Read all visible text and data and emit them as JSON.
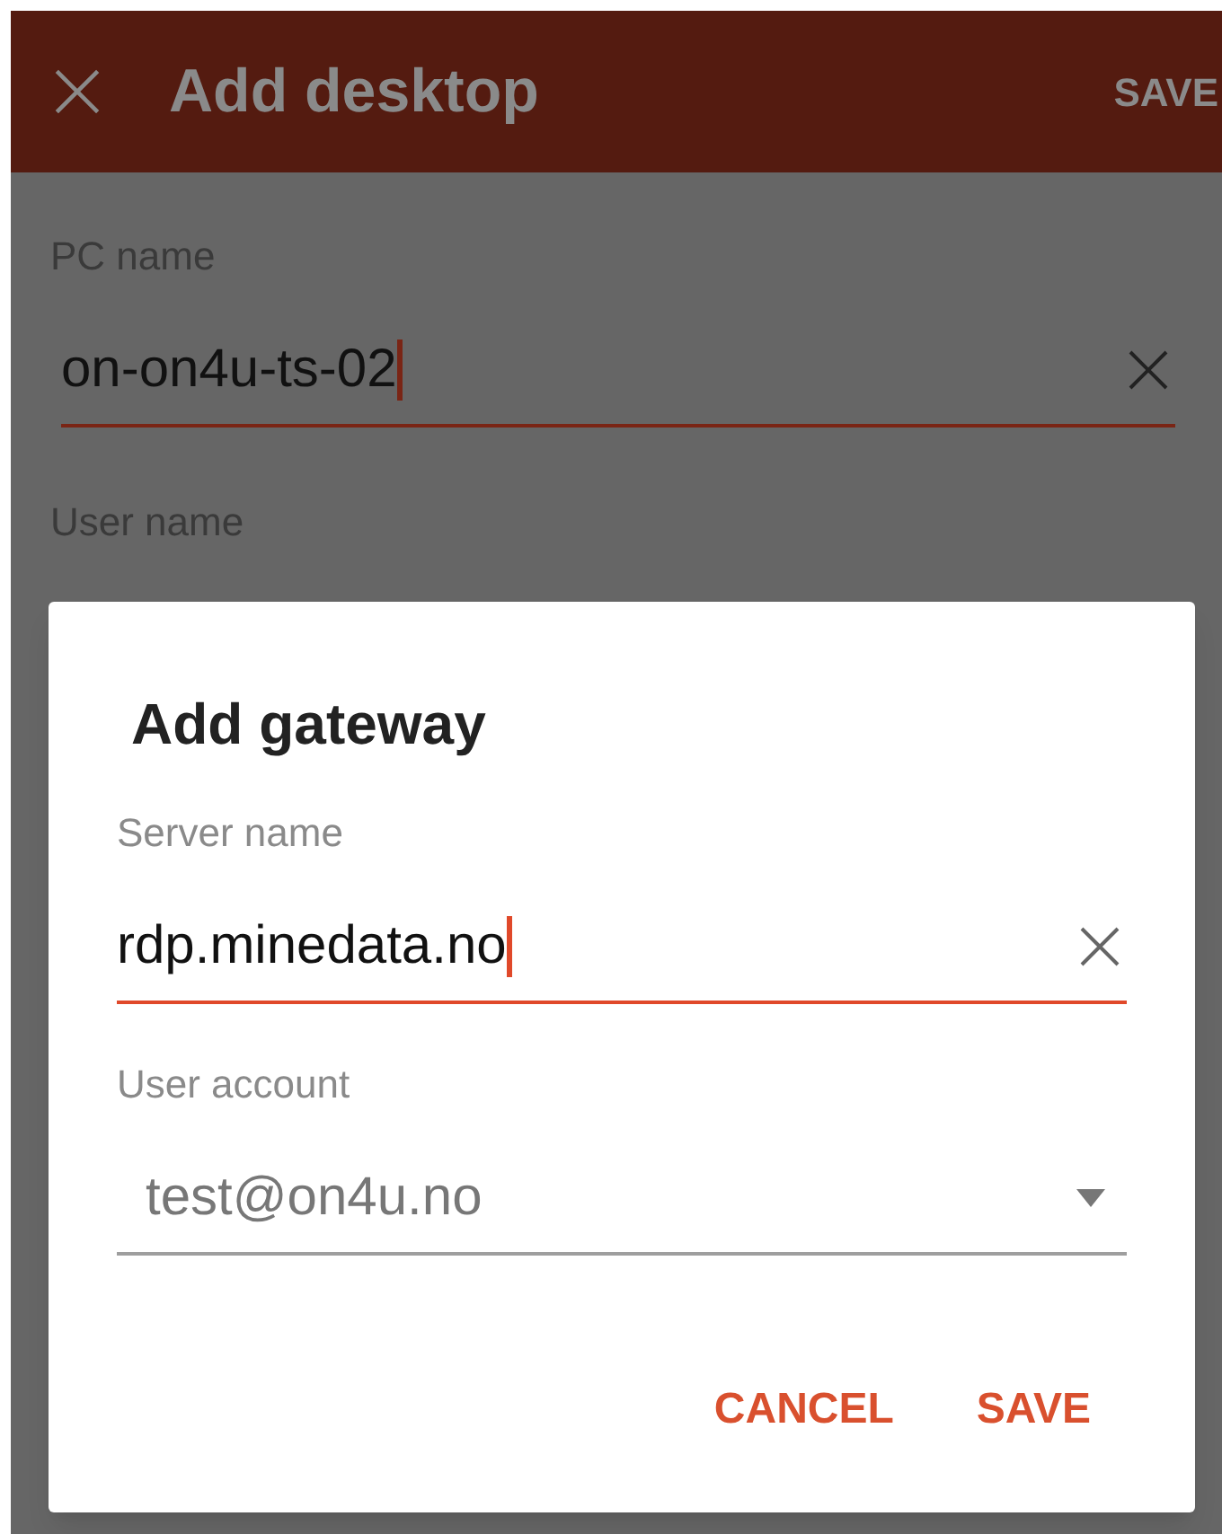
{
  "app_bar": {
    "title": "Add desktop",
    "action": "SAVE"
  },
  "form": {
    "fields": [
      {
        "label": "PC name",
        "value": "on-on4u-ts-02",
        "focused": true
      }
    ],
    "next_label": "User name"
  },
  "dialog": {
    "title": "Add gateway",
    "fields": [
      {
        "kind": "text",
        "label": "Server name",
        "value": "rdp.minedata.no",
        "focused": true
      },
      {
        "kind": "select",
        "label": "User account",
        "value": "test@on4u.no",
        "focused": false
      }
    ],
    "buttons": [
      "CANCEL",
      "SAVE"
    ]
  }
}
